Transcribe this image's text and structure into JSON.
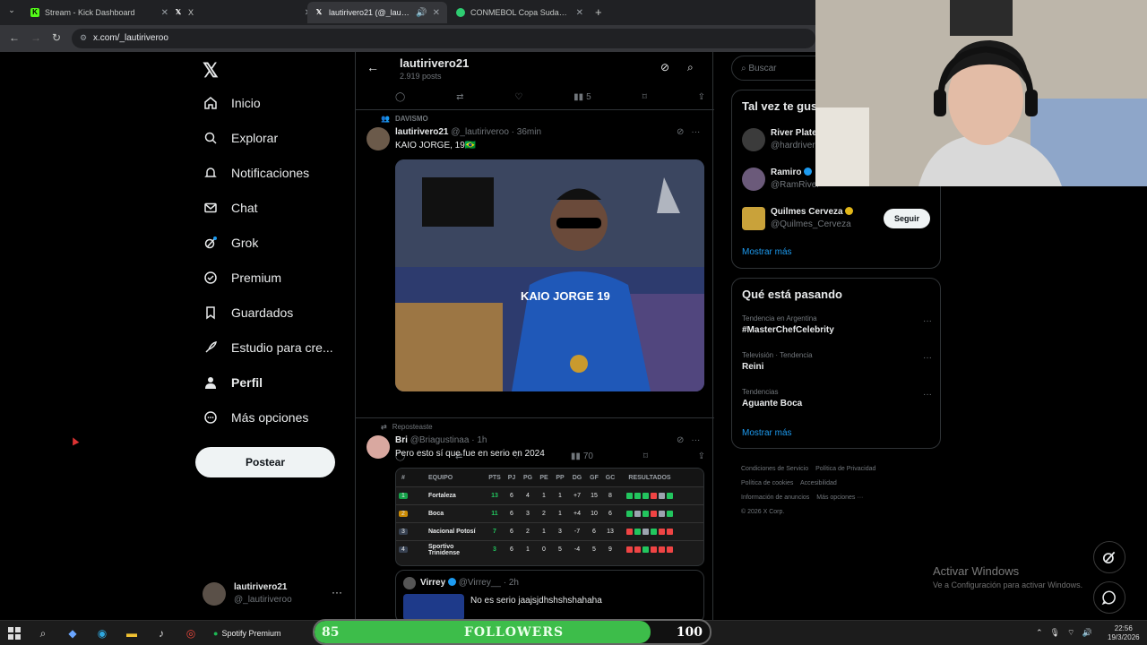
{
  "browser": {
    "tabs": [
      {
        "title": "Stream - Kick Dashboard",
        "favicon": "kick-icon",
        "color": "#53fc18",
        "active": false
      },
      {
        "title": "X",
        "favicon": "x-icon",
        "color": "#ffffff",
        "active": false
      },
      {
        "title": "lautirivero21 (@_lautiriveroo)",
        "favicon": "x-icon",
        "color": "#ffffff",
        "active": true
      },
      {
        "title": "CONMEBOL Copa Sudamericana",
        "favicon": "conmebol-icon",
        "color": "#2ecc71",
        "active": false
      }
    ],
    "url": "x.com/_lautiriveroo"
  },
  "nav": {
    "logo": "𝕏",
    "items": [
      {
        "label": "Inicio",
        "icon": "home-icon"
      },
      {
        "label": "Explorar",
        "icon": "search-icon"
      },
      {
        "label": "Notificaciones",
        "icon": "bell-icon"
      },
      {
        "label": "Chat",
        "icon": "mail-icon"
      },
      {
        "label": "Grok",
        "icon": "grok-icon"
      },
      {
        "label": "Premium",
        "icon": "premium-icon"
      },
      {
        "label": "Guardados",
        "icon": "bookmark-icon"
      },
      {
        "label": "Estudio para cre...",
        "icon": "rocket-icon"
      },
      {
        "label": "Perfil",
        "icon": "person-icon"
      },
      {
        "label": "Más opciones",
        "icon": "more-circle-icon"
      }
    ],
    "post_button": "Postear",
    "account": {
      "name": "lautirivero21",
      "handle": "@_lautiriveroo"
    }
  },
  "feed": {
    "header": {
      "name": "lautirivero21",
      "posts": "2.919 posts"
    },
    "top_actions": {
      "views": "5"
    },
    "tweet1": {
      "context": "DAVISMO",
      "author": "lautirivero21",
      "handle": "@_lautiriveroo",
      "time": "36min",
      "text": "KAIO JORGE, 19🇧🇷",
      "views": "70",
      "media_caption": "KAIO JORGE 19"
    },
    "tweet2": {
      "context": "Reposteaste",
      "author": "Bri",
      "handle": "@Briagustinaa",
      "time": "1h",
      "text": "Pero esto sí que fue en serio en 2024",
      "table": {
        "headers": [
          "#",
          "EQUIPO",
          "PTS",
          "PJ",
          "PG",
          "PE",
          "PP",
          "DG",
          "GF",
          "GC",
          "RESULTADOS"
        ],
        "rows": [
          [
            "1",
            "Fortaleza",
            "13",
            "6",
            "4",
            "1",
            "1",
            "+7",
            "15",
            "8"
          ],
          [
            "2",
            "Boca",
            "11",
            "6",
            "3",
            "2",
            "1",
            "+4",
            "10",
            "6"
          ],
          [
            "3",
            "Nacional Potosí",
            "7",
            "6",
            "2",
            "1",
            "3",
            "-7",
            "6",
            "13"
          ],
          [
            "4",
            "Sportivo Trinidense",
            "3",
            "6",
            "1",
            "0",
            "5",
            "-4",
            "5",
            "9"
          ]
        ]
      },
      "quote": {
        "author": "Virrey",
        "handle": "@Virrey__",
        "time": "2h",
        "text": "No es serio jaajsjdhshshshahaha"
      }
    }
  },
  "right": {
    "search_placeholder": "Buscar",
    "suggest_title": "Tal vez te gus",
    "suggestions": [
      {
        "name": "River Plate",
        "handle": "@hardriver"
      },
      {
        "name": "Ramiro",
        "handle": "@RamRiver"
      },
      {
        "name": "Quilmes Cerveza",
        "handle": "@Quilmes_Cerveza",
        "button": "Seguir"
      }
    ],
    "show_more": "Mostrar más",
    "trends_title": "Qué está pasando",
    "trends": [
      {
        "category": "Tendencia en Argentina",
        "topic": "#MasterChefCelebrity"
      },
      {
        "category": "Televisión · Tendencia",
        "topic": "Reini"
      },
      {
        "category": "Tendencias",
        "topic": "Aguante Boca"
      }
    ],
    "trends_more": "Mostrar más",
    "footer": [
      "Condiciones de Servicio",
      "Política de Privacidad",
      "Política de cookies",
      "Accesibilidad",
      "Información de anuncios",
      "Más opciones ···",
      "© 2026 X Corp."
    ]
  },
  "overlay": {
    "watermark_title": "Activar Windows",
    "watermark_sub": "Ve a Configuración para activar Windows.",
    "followers": {
      "label": "FOLLOWERS",
      "current": "85",
      "goal": "100",
      "progress": 0.85
    }
  },
  "taskbar": {
    "spotify": "Spotify Premium",
    "time": "22:56",
    "date": "19/3/2026"
  },
  "colors": {
    "accent": "#1d9bf0",
    "bg": "#000000",
    "border": "#2f3336",
    "muted": "#71767b"
  }
}
